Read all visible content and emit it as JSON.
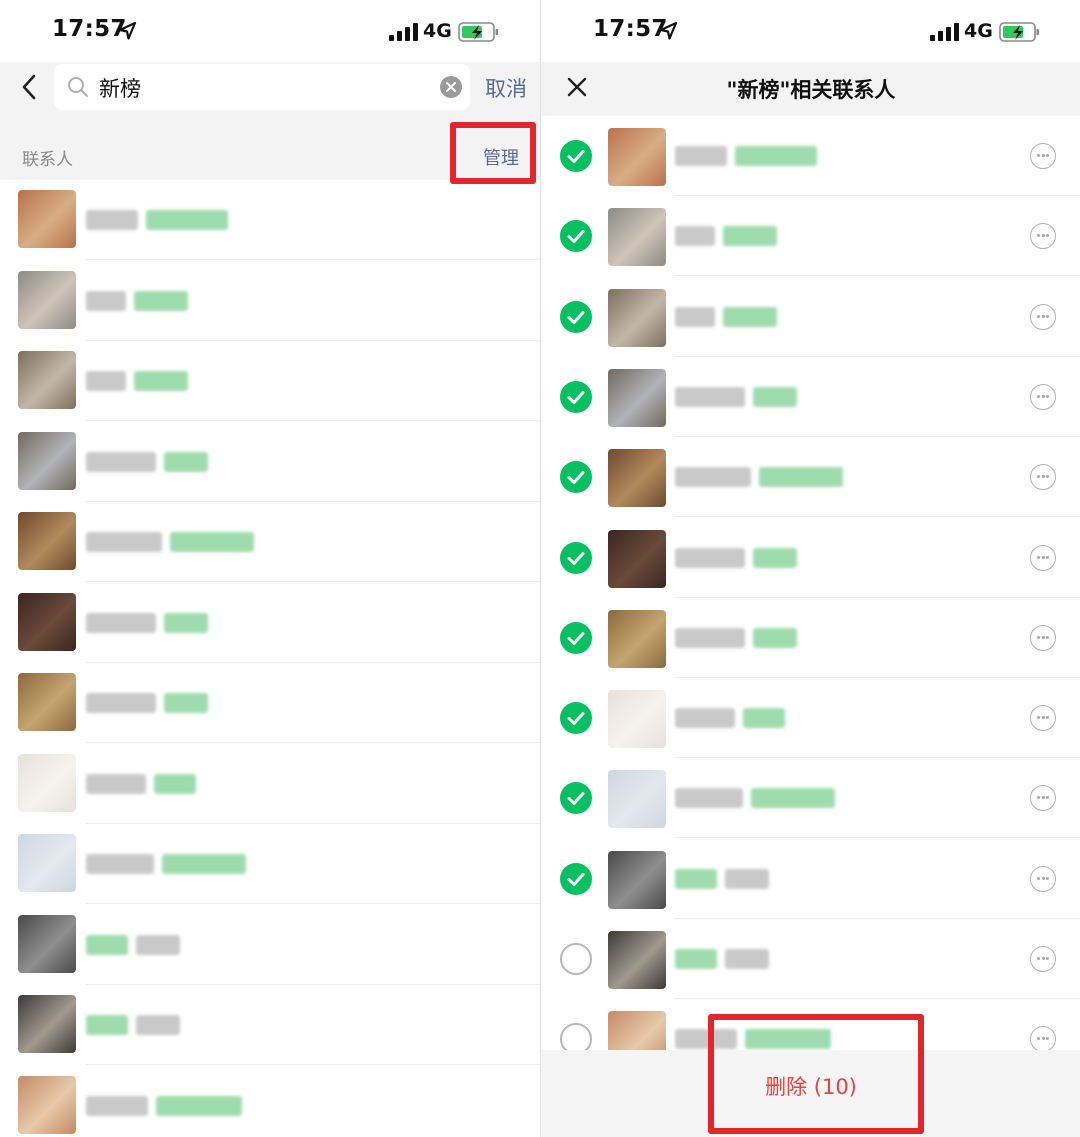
{
  "status": {
    "time": "17:57",
    "network": "4G"
  },
  "left": {
    "search_value": "新榜",
    "cancel_label": "取消",
    "section_label": "联系人",
    "manage_label": "管理",
    "avatar_colors": [
      [
        "#b9714a",
        "#d8ad86"
      ],
      [
        "#8d8a86",
        "#cfc4b8"
      ],
      [
        "#7e6f5c",
        "#c3b7a9"
      ],
      [
        "#6f6a5e",
        "#b2b3b8"
      ],
      [
        "#6e4a2e",
        "#b18a5d"
      ],
      [
        "#3a2620",
        "#6a4a3a"
      ],
      [
        "#8a6a3e",
        "#c4a46e"
      ],
      [
        "#e8e1dc",
        "#f5f2ef"
      ],
      [
        "#cfd6e3",
        "#e4e8ee"
      ],
      [
        "#4a4a4a",
        "#8e8e8e"
      ],
      [
        "#3c3a38",
        "#a2998f"
      ],
      [
        "#c48a66",
        "#e7c9a9"
      ]
    ]
  },
  "right": {
    "title": "\"新榜\"相关联系人",
    "delete_label": "删除 (10)",
    "checked": [
      true,
      true,
      true,
      true,
      true,
      true,
      true,
      true,
      true,
      true,
      false,
      false
    ],
    "avatar_colors": [
      [
        "#b9714a",
        "#d8ad86"
      ],
      [
        "#8d8a86",
        "#cfc4b8"
      ],
      [
        "#7e6f5c",
        "#c3b7a9"
      ],
      [
        "#6f6a5e",
        "#b2b3b8"
      ],
      [
        "#6e4a2e",
        "#b18a5d"
      ],
      [
        "#3a2620",
        "#6a4a3a"
      ],
      [
        "#8a6a3e",
        "#c4a46e"
      ],
      [
        "#e8e1dc",
        "#f5f2ef"
      ],
      [
        "#cfd6e3",
        "#e4e8ee"
      ],
      [
        "#4a4a4a",
        "#8e8e8e"
      ],
      [
        "#3c3a38",
        "#a2998f"
      ],
      [
        "#c48a66",
        "#e7c9a9"
      ]
    ]
  },
  "colors": {
    "accent_green": "#07c160",
    "link_blue": "#576b95",
    "highlight_red": "#e2262b",
    "delete_red": "#e64340"
  }
}
